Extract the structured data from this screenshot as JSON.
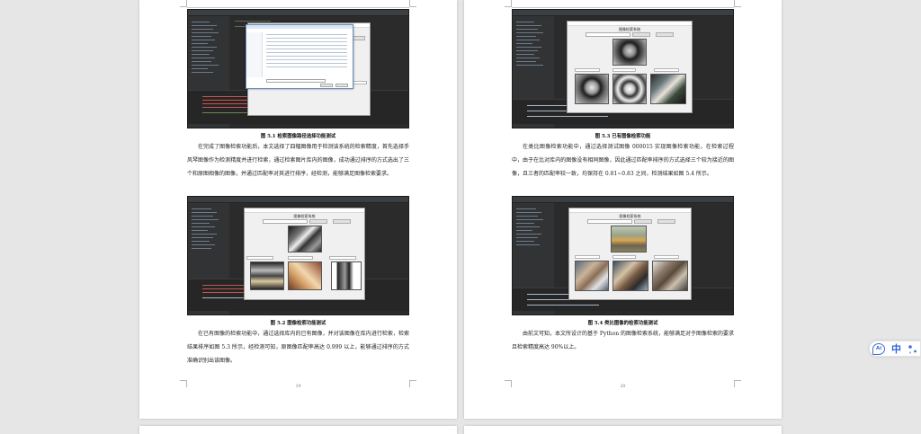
{
  "left_page": {
    "figure_5_1": {
      "caption": "图 5.1  检索图像路径选择功能测试"
    },
    "para_1": "在完成了图像检索功能后，本文选择了四幅图像用于检测该系统的检索精度，首先选择手风琴图像作为检测精度并进行检索，通过检索图片库内的图像，成功通过排序的方式选出了三个和原图相像的图像，并通过匹配率对其进行排序，经检测，能够满足图像检索要求。",
    "figure_5_2": {
      "caption": "图 5.2  图像检索功能测试"
    },
    "para_2": "在已有图像的检索功能中，通过选择库内的已有图像，并对该图像在库内进行检索，检索结果排序如图 5.3 所示，经检测可知，原图像匹配率高达 0.999 以上，能够通过排序的方式准确识别出该图像。",
    "page_number": "19"
  },
  "right_page": {
    "figure_5_3": {
      "caption": "图 5.3  已有图像检索功能"
    },
    "para_1": "在类比图像检索功能中，通过选择测试图像 000015 实现图像检索功能，在检索过程中，由于在比对库内的图像没有相同图像，因此通过匹配率排序的方式选择三个较为接近的图像，且三者的匹配率较一致，均保持在 0.81~0.83 之间，检测结果如图 5.4 所示。",
    "figure_5_4": {
      "caption": "图 5.4  类比图像的检索功能测试"
    },
    "para_2": "由前文可知，本文所设计的基于 Python 的图像检索系统，能够满足对于图像检索的要求且检索精度高达 90%以上。",
    "page_number": "20"
  },
  "toolbar": {
    "ai_label": "Ai",
    "lang_label": "中",
    "icons": [
      "ai-assistant-icon",
      "chinese-input-icon",
      "dots-settings-icon"
    ]
  },
  "colors": {
    "background": "#e6e6e6",
    "page": "#ffffff",
    "ide_dark": "#2b2b2b",
    "accent_blue": "#2f66d4"
  }
}
